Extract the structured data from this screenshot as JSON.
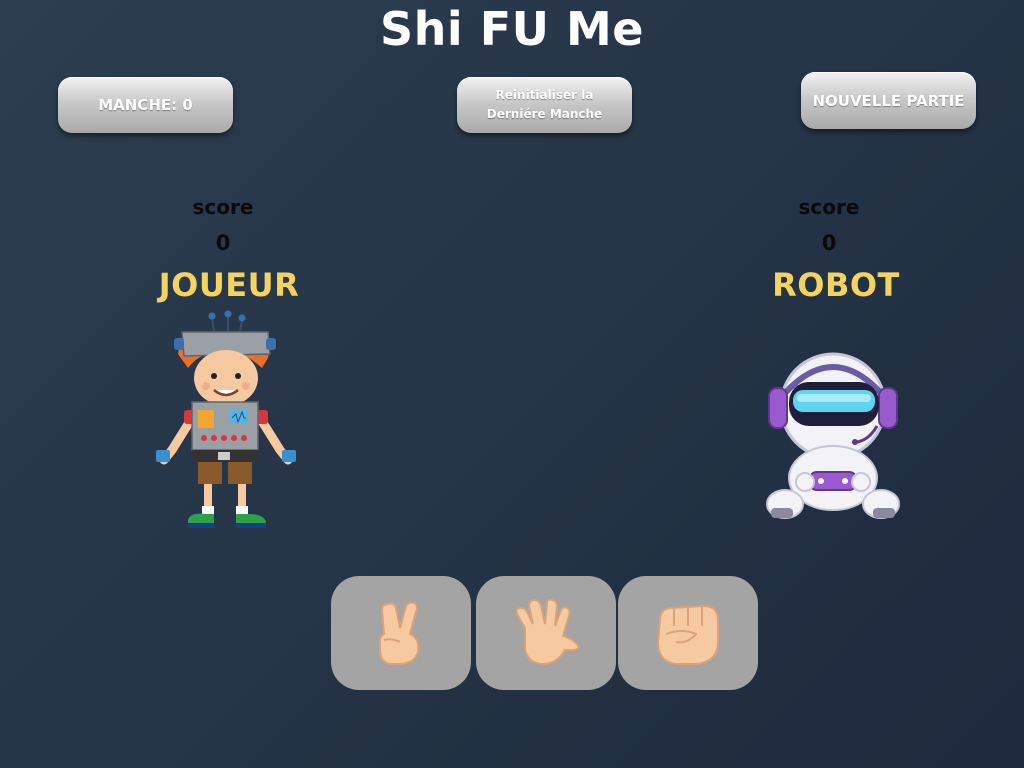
{
  "app": {
    "title": "Shi FU Me"
  },
  "toolbar": {
    "round_label": "MANCHE: 0",
    "reset_label": "Reinitialiser la Derniére Manche",
    "new_game_label": "NOUVELLE PARTIE"
  },
  "player": {
    "score_label": "score",
    "score": "0",
    "name": "JOUEUR",
    "avatar_icon": "robot-costume-kid-icon"
  },
  "robot": {
    "score_label": "score",
    "score": "0",
    "name": "ROBOT",
    "avatar_icon": "astronaut-gamer-icon"
  },
  "choices": [
    {
      "name": "scissors",
      "icon": "peace-hand-icon"
    },
    {
      "name": "paper",
      "icon": "open-hand-icon"
    },
    {
      "name": "rock",
      "icon": "fist-icon"
    }
  ],
  "colors": {
    "background": "#2c3e50",
    "accent": "#f4d35e",
    "button": "#bdbdbd",
    "choice_button": "#a3a4a3",
    "skin": "#f6c9a0"
  }
}
